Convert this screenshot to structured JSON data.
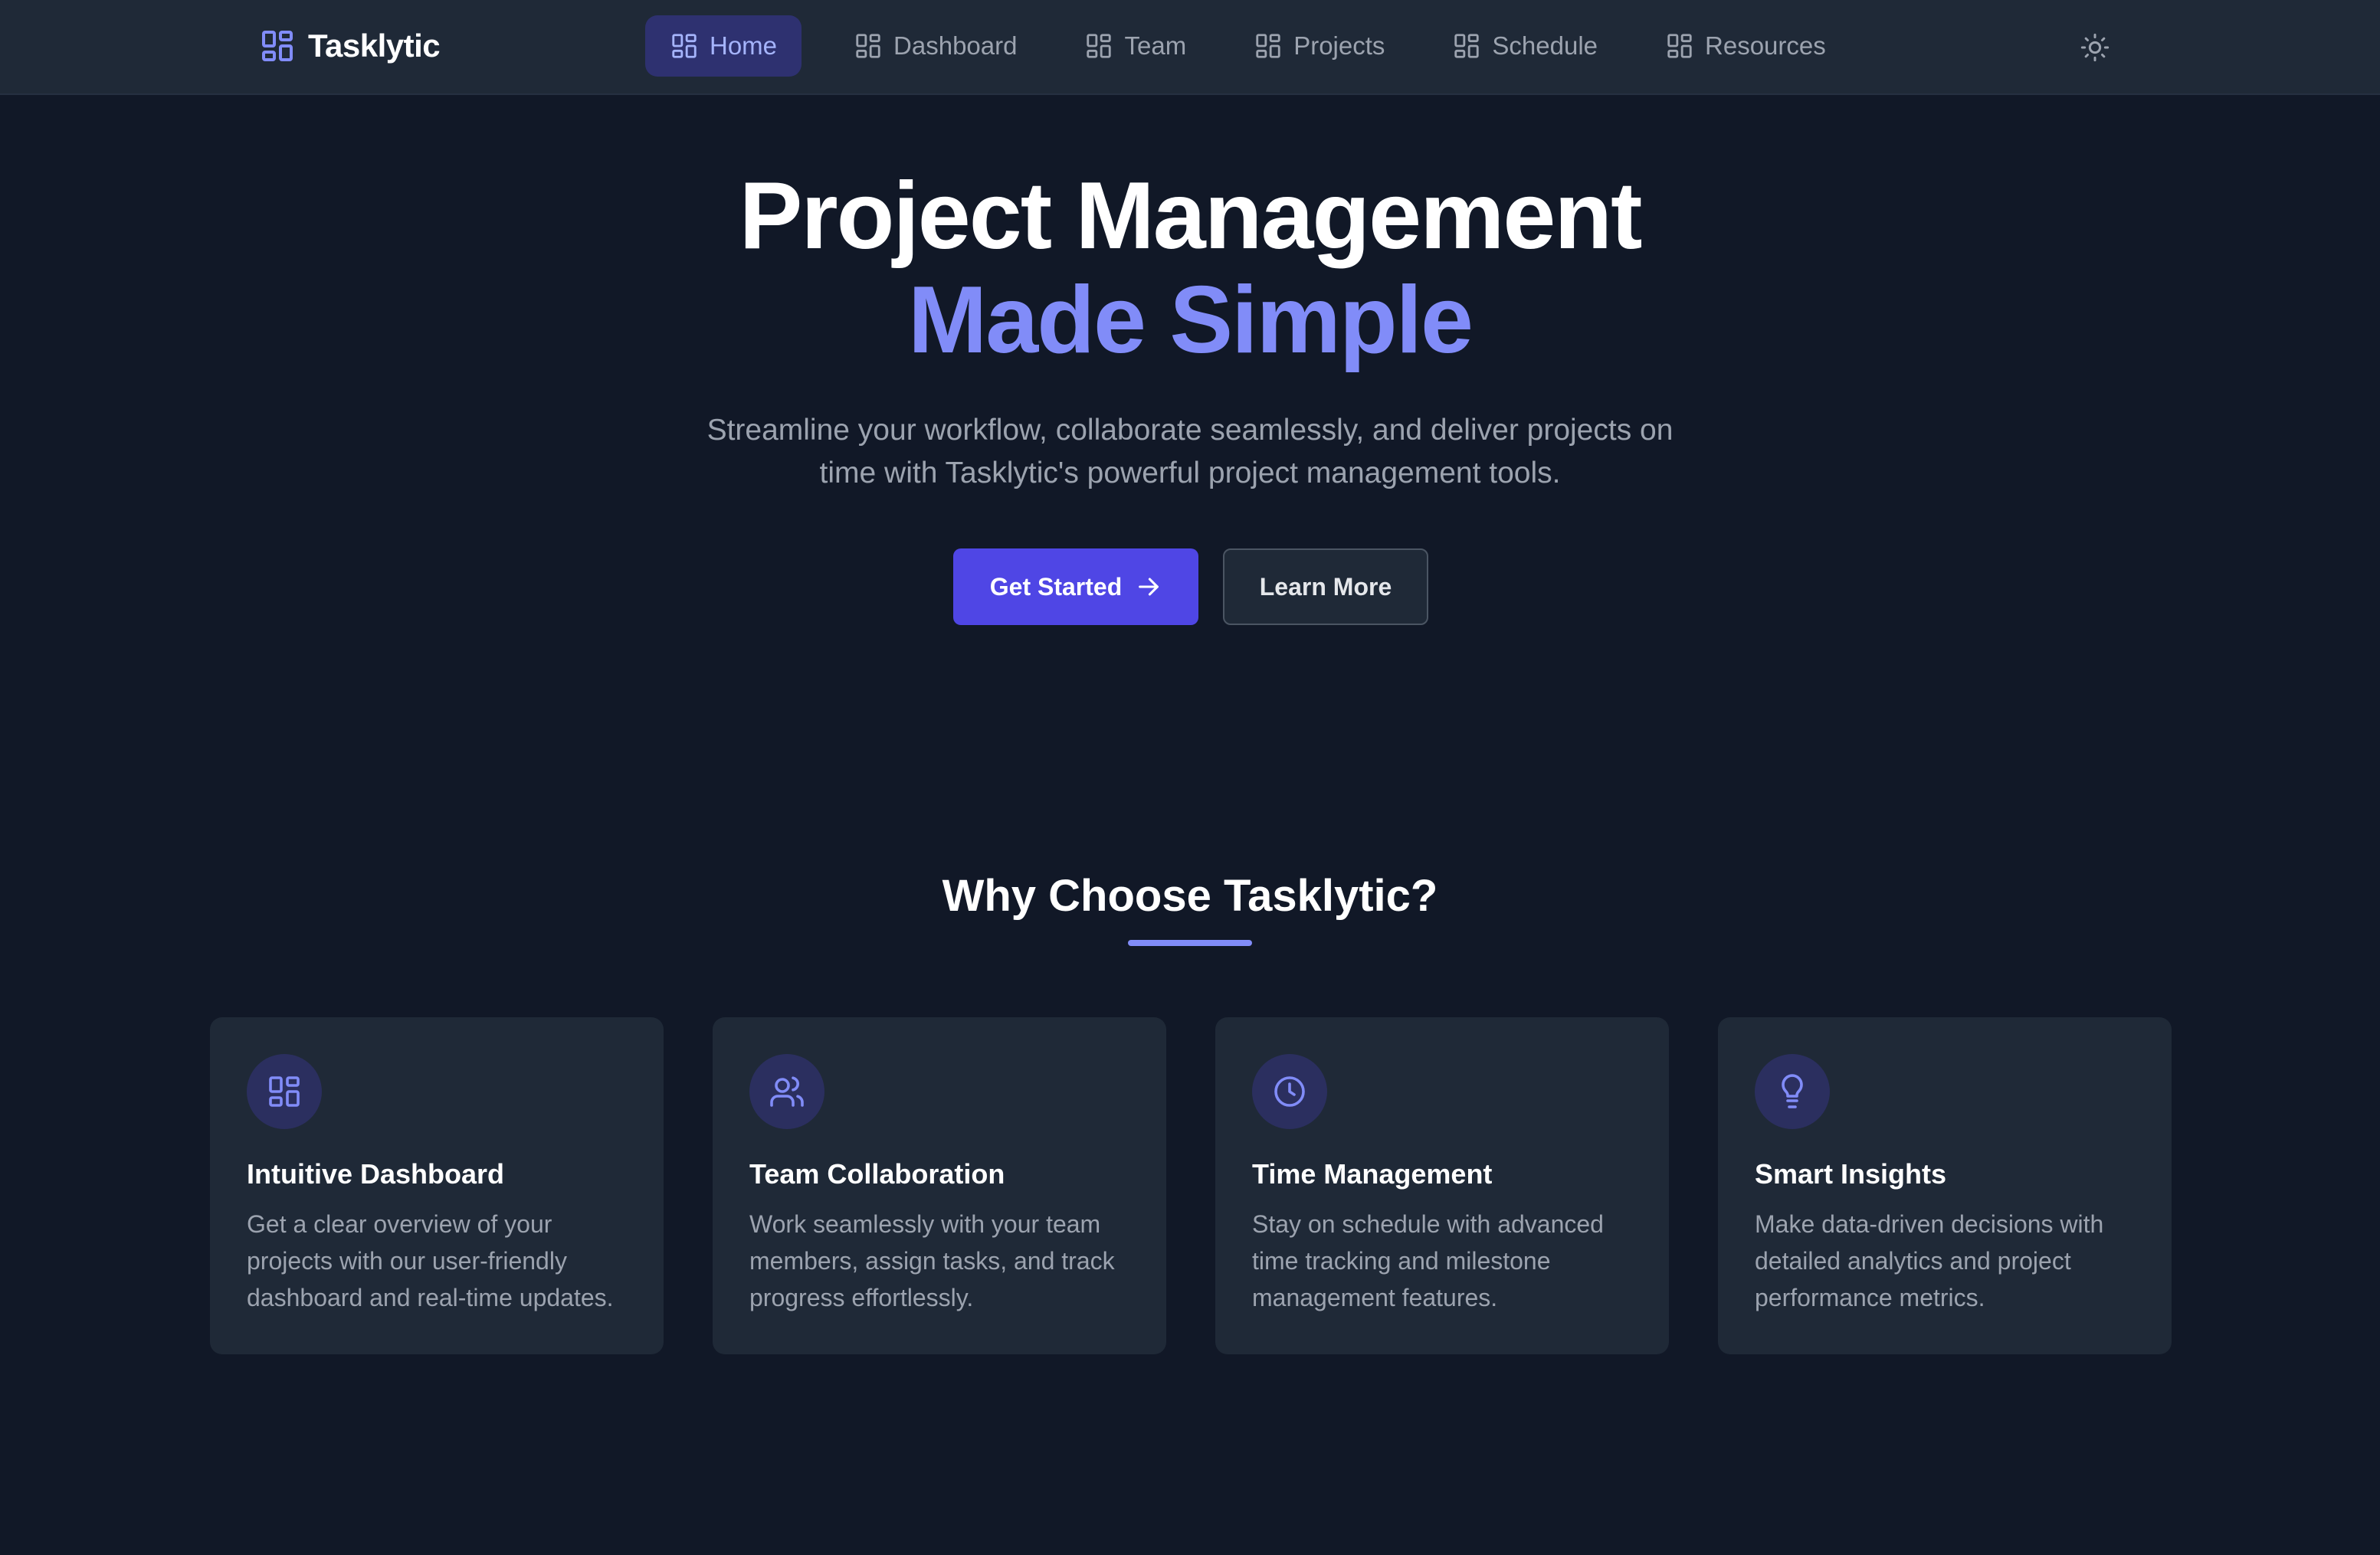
{
  "header": {
    "brand": "Tasklytic",
    "brand_icon": "layout-grid-icon",
    "nav": [
      {
        "label": "Home",
        "icon": "layout-grid-icon",
        "active": true
      },
      {
        "label": "Dashboard",
        "icon": "layout-grid-icon",
        "active": false
      },
      {
        "label": "Team",
        "icon": "layout-grid-icon",
        "active": false
      },
      {
        "label": "Projects",
        "icon": "layout-grid-icon",
        "active": false
      },
      {
        "label": "Schedule",
        "icon": "layout-grid-icon",
        "active": false
      },
      {
        "label": "Resources",
        "icon": "layout-grid-icon",
        "active": false
      }
    ],
    "theme_toggle_icon": "sun-icon"
  },
  "hero": {
    "title_line1": "Project Management",
    "title_line2": "Made Simple",
    "subtitle": "Streamline your workflow, collaborate seamlessly, and deliver projects on time with Tasklytic's powerful project management tools.",
    "primary_button": "Get Started",
    "primary_button_icon": "arrow-right-icon",
    "secondary_button": "Learn More"
  },
  "features": {
    "title": "Why Choose Tasklytic?",
    "cards": [
      {
        "icon": "layout-grid-icon",
        "title": "Intuitive Dashboard",
        "description": "Get a clear overview of your projects with our user-friendly dashboard and real-time updates."
      },
      {
        "icon": "users-icon",
        "title": "Team Collaboration",
        "description": "Work seamlessly with your team members, assign tasks, and track progress effortlessly."
      },
      {
        "icon": "clock-icon",
        "title": "Time Management",
        "description": "Stay on schedule with advanced time tracking and milestone management features."
      },
      {
        "icon": "lightbulb-icon",
        "title": "Smart Insights",
        "description": "Make data-driven decisions with detailed analytics and project performance metrics."
      }
    ]
  },
  "colors": {
    "background": "#111827",
    "surface": "#1f2937",
    "accent": "#818cf8",
    "primary_button": "#4f46e5"
  }
}
